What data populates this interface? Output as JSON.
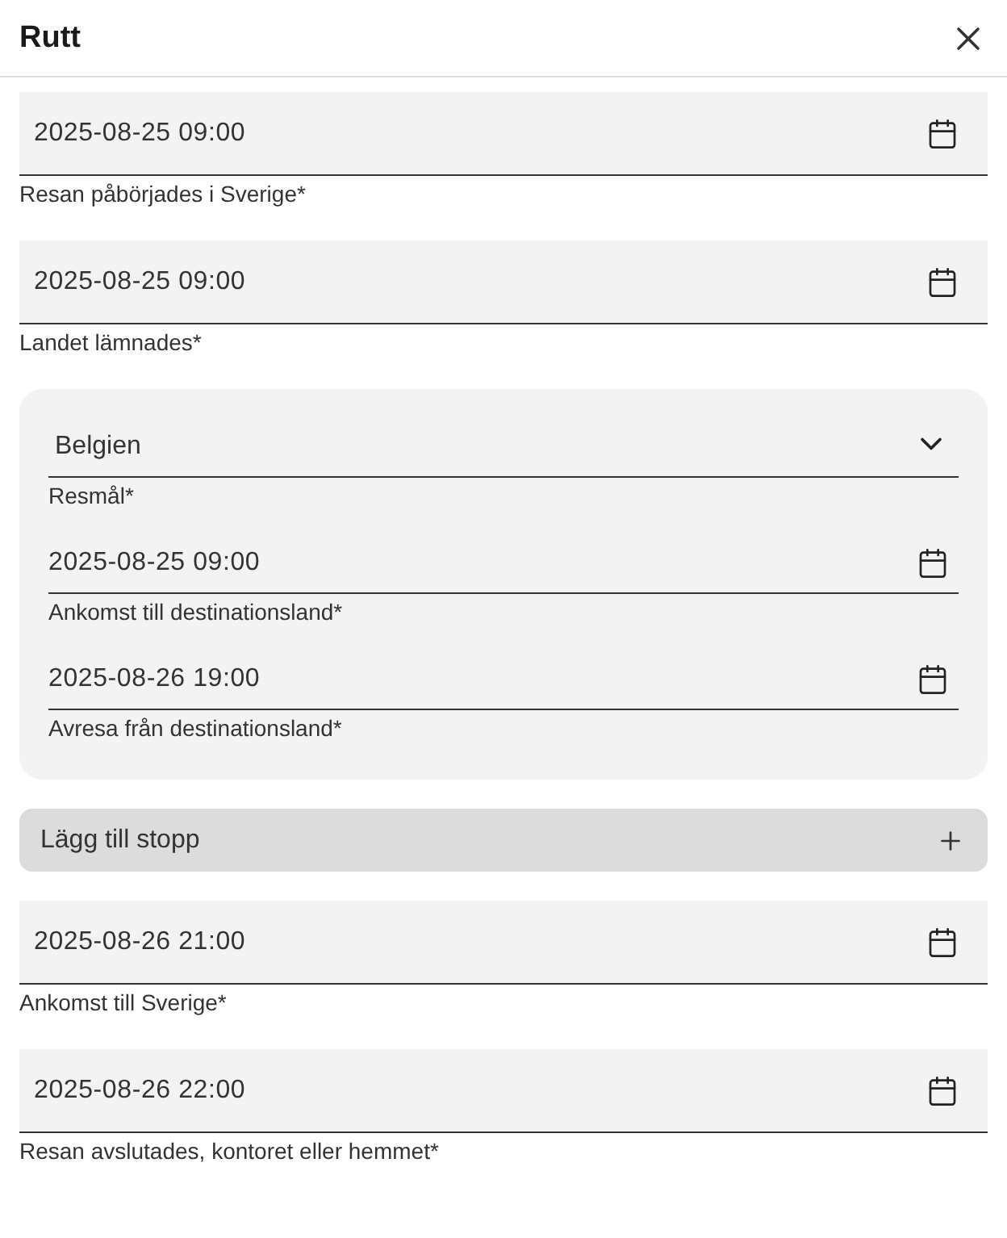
{
  "header": {
    "title": "Rutt"
  },
  "sections": [
    {
      "kind": "date",
      "value": "2025-08-25 09:00",
      "label": "Resan påbörjades i Sverige*"
    },
    {
      "kind": "date",
      "value": "2025-08-25 09:00",
      "label": "Landet lämnades*"
    },
    {
      "kind": "destination",
      "select": {
        "value": "Belgien",
        "label": "Resmål*"
      },
      "dates": [
        {
          "value": "2025-08-25 09:00",
          "label": "Ankomst till destinationsland*"
        },
        {
          "value": "2025-08-26 19:00",
          "label": "Avresa från destinationsland*"
        }
      ]
    },
    {
      "kind": "add",
      "label": "Lägg till stopp"
    },
    {
      "kind": "date",
      "value": "2025-08-26 21:00",
      "label": "Ankomst till Sverige*"
    },
    {
      "kind": "date",
      "value": "2025-08-26 22:00",
      "label": "Resan avslutades, kontoret eller hemmet*"
    }
  ]
}
